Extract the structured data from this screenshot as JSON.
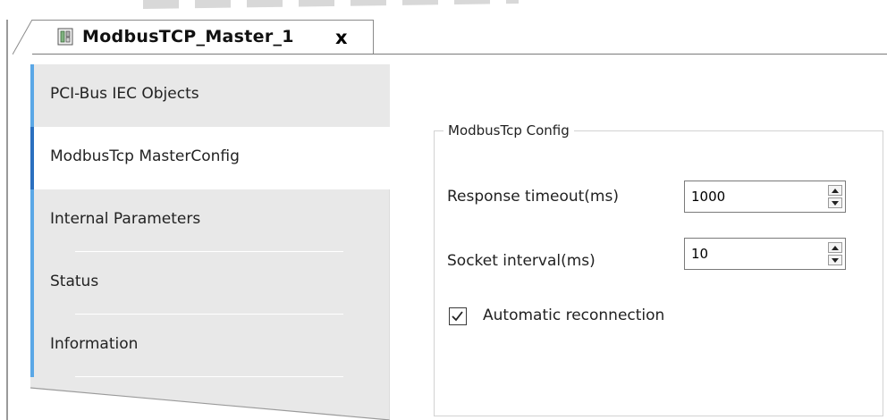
{
  "document_tab": {
    "title": "ModbusTCP_Master_1",
    "close_glyph": "x",
    "icon": "device-module-icon"
  },
  "nav": {
    "items": [
      {
        "label": "PCI-Bus IEC Objects",
        "active": false
      },
      {
        "label": "ModbusTcp MasterConfig",
        "active": true
      },
      {
        "label": "Internal Parameters",
        "active": false
      },
      {
        "label": "Status",
        "active": false
      },
      {
        "label": "Information",
        "active": false
      }
    ]
  },
  "config": {
    "group_title": "ModbusTcp Config",
    "response_timeout": {
      "label": "Response timeout(ms)",
      "value": "1000"
    },
    "socket_interval": {
      "label": "Socket interval(ms)",
      "value": "10"
    },
    "auto_reconnect": {
      "label": "Automatic reconnection",
      "checked": true
    }
  },
  "colors": {
    "nav_bg": "#e8e8e8",
    "nav_accent": "#5aa7e6",
    "active_accent": "#2a6fbf",
    "group_border": "#d2d2d2"
  }
}
